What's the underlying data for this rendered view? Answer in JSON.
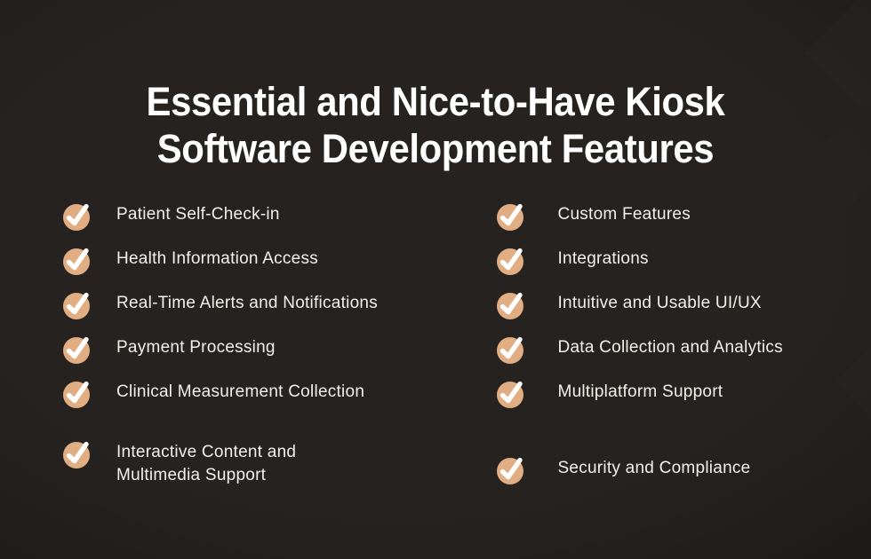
{
  "theme": {
    "background_color": "#252220",
    "accent_color": "#E0AE82",
    "title_color": "#FFFFFF",
    "label_color": "#F3F0EC",
    "check_color": "#FFFFFF"
  },
  "header": {
    "title": "Essential and Nice-to-Have Kiosk\nSoftware Development Features",
    "title_line_1": "Essential and Nice-to-Have Kiosk",
    "title_line_2": "Software Development Features"
  },
  "columns": {
    "left": {
      "icon_name": "check-circle-icon",
      "items": [
        {
          "label": "Patient Self-Check-in"
        },
        {
          "label": "Health Information Access"
        },
        {
          "label": "Real-Time Alerts and Notifications"
        },
        {
          "label": "Payment Processing"
        },
        {
          "label": "Clinical Measurement Collection"
        },
        {
          "label": "Interactive Content and\nMultimedia Support"
        }
      ]
    },
    "right": {
      "icon_name": "check-circle-icon",
      "items": [
        {
          "label": "Custom Features"
        },
        {
          "label": "Integrations"
        },
        {
          "label": "Intuitive and Usable UI/UX"
        },
        {
          "label": "Data Collection and Analytics"
        },
        {
          "label": "Multiplatform Support"
        },
        {
          "label": "Security and Compliance"
        }
      ]
    }
  }
}
